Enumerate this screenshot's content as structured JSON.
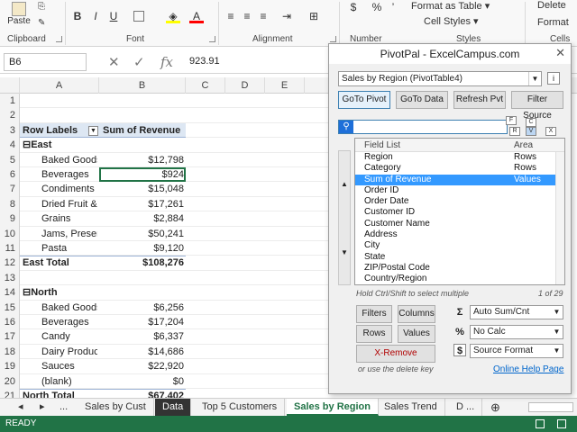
{
  "ribbon": {
    "paste_label": "Paste",
    "groups": [
      {
        "label": "Clipboard"
      },
      {
        "label": "Font"
      },
      {
        "label": "Alignment"
      },
      {
        "label": "Number"
      },
      {
        "label": "Styles"
      },
      {
        "label": "Cells"
      }
    ],
    "format_as_table": "Format as Table",
    "cell_styles": "Cell Styles",
    "delete_label": "Delete",
    "format_label": "Format",
    "number_symbols": [
      "$",
      "%",
      "’"
    ],
    "font_buttons": [
      "B",
      "I",
      "U"
    ]
  },
  "formula_bar": {
    "name_box": "B6",
    "value": "923.91"
  },
  "columns": [
    "A",
    "B",
    "C",
    "D",
    "E"
  ],
  "rows": [
    {
      "n": "1",
      "a": "",
      "b": "",
      "type": "empty"
    },
    {
      "n": "2",
      "a": "",
      "b": "",
      "type": "empty"
    },
    {
      "n": "3",
      "a": "Row Labels",
      "b": "Sum of Revenue",
      "type": "header"
    },
    {
      "n": "4",
      "a": "⊟East",
      "b": "",
      "type": "group"
    },
    {
      "n": "5",
      "a": "Baked Goods",
      "b": "$12,798",
      "type": "item"
    },
    {
      "n": "6",
      "a": "Beverages",
      "b": "$924",
      "type": "item"
    },
    {
      "n": "7",
      "a": "Condiments",
      "b": "$15,048",
      "type": "item"
    },
    {
      "n": "8",
      "a": "Dried Fruit &",
      "b": "$17,261",
      "type": "item"
    },
    {
      "n": "9",
      "a": "Grains",
      "b": "$2,884",
      "type": "item"
    },
    {
      "n": "10",
      "a": "Jams, Presen",
      "b": "$50,241",
      "type": "item"
    },
    {
      "n": "11",
      "a": "Pasta",
      "b": "$9,120",
      "type": "item"
    },
    {
      "n": "12",
      "a": "East Total",
      "b": "$108,276",
      "type": "total"
    },
    {
      "n": "13",
      "a": "",
      "b": "",
      "type": "empty"
    },
    {
      "n": "14",
      "a": "⊟North",
      "b": "",
      "type": "group"
    },
    {
      "n": "15",
      "a": "Baked Goods",
      "b": "$6,256",
      "type": "item"
    },
    {
      "n": "16",
      "a": "Beverages",
      "b": "$17,204",
      "type": "item"
    },
    {
      "n": "17",
      "a": "Candy",
      "b": "$6,337",
      "type": "item"
    },
    {
      "n": "18",
      "a": "Dairy Product",
      "b": "$14,686",
      "type": "item"
    },
    {
      "n": "19",
      "a": "Sauces",
      "b": "$22,920",
      "type": "item"
    },
    {
      "n": "20",
      "a": "(blank)",
      "b": "$0",
      "type": "item"
    },
    {
      "n": "21",
      "a": "North Total",
      "b": "$67,402",
      "type": "total"
    }
  ],
  "sheet_tabs": [
    {
      "label": "Sales by Cust",
      "state": "normal"
    },
    {
      "label": "Data",
      "state": "dark"
    },
    {
      "label": "Top 5 Customers",
      "state": "normal"
    },
    {
      "label": "Sales by Region",
      "state": "active"
    },
    {
      "label": "Sales Trend",
      "state": "normal"
    },
    {
      "label": "D ...",
      "state": "normal"
    }
  ],
  "status": "READY",
  "pivotpal": {
    "title": "PivotPal  -  ExcelCampus.com",
    "pivot_select": "Sales by Region (PivotTable4)",
    "buttons": [
      "GoTo Pivot",
      "GoTo Data",
      "Refresh Pvt",
      "Filter Source"
    ],
    "list_header_field": "Field List",
    "list_header_area": "Area",
    "fields": [
      {
        "field": "Region",
        "area": "Rows"
      },
      {
        "field": "Category",
        "area": "Rows"
      },
      {
        "field": "Sum of Revenue",
        "area": "Values",
        "selected": true
      },
      {
        "field": "Order ID",
        "area": ""
      },
      {
        "field": "Order Date",
        "area": ""
      },
      {
        "field": "Customer ID",
        "area": ""
      },
      {
        "field": "Customer Name",
        "area": ""
      },
      {
        "field": "Address",
        "area": ""
      },
      {
        "field": "City",
        "area": ""
      },
      {
        "field": "State",
        "area": ""
      },
      {
        "field": "ZIP/Postal Code",
        "area": ""
      },
      {
        "field": "Country/Region",
        "area": ""
      }
    ],
    "hint_multi": "Hold Ctrl/Shift to select multiple",
    "count": "1 of 29",
    "area_buttons": [
      "Filters",
      "Columns",
      "Rows",
      "Values"
    ],
    "remove_button": "X-Remove",
    "hint_delete": "or use the delete key",
    "sum_combo": "Auto Sum/Cnt",
    "calc_combo": "No Calc",
    "format_combo": "Source Format",
    "help_link": "Online Help Page"
  }
}
